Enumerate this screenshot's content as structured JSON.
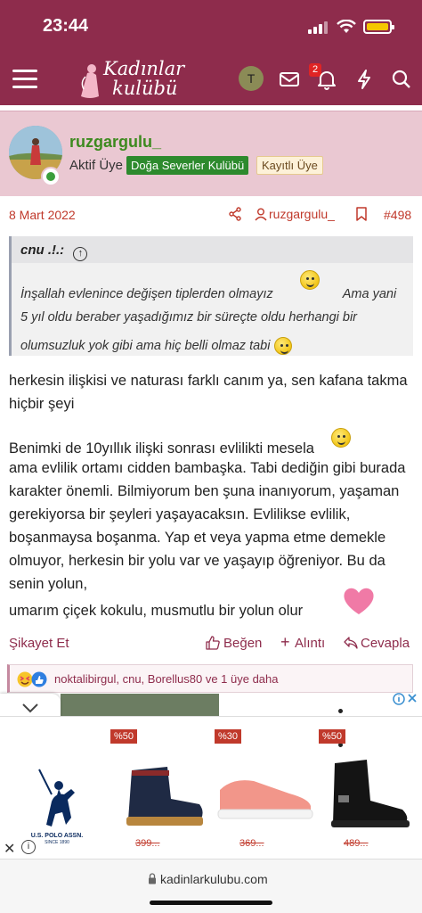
{
  "status_bar": {
    "time": "23:44"
  },
  "nav": {
    "logo_line1": "Kadınlar",
    "logo_line2": "kulübü",
    "avatar_letter": "T",
    "notification_count": "2"
  },
  "post": {
    "username": "ruzgargulu_",
    "user_title": "Aktif Üye",
    "badge_group": "Doğa Severler Kulübü",
    "badge_status": "Kayıtlı Üye",
    "date": "8 Mart 2022",
    "author_link": "ruzgargulu_",
    "post_number": "#498",
    "quote": {
      "author": "cnu .!.:",
      "line1": "İnşallah evlenince değişen tiplerden olmayız",
      "line1b": "Ama yani",
      "line2": "5 yıl oldu beraber yaşadığımız bir süreçte oldu herhangi bir",
      "line3": "olumsuzluk yok gibi ama hiç belli olmaz tabi"
    },
    "para1": "herkesin ilişkisi ve naturası farklı canım ya, sen kafana takma hiçbir şeyi",
    "para2_line1": "Benimki de 10yıllık ilişki sonrası evlilikti mesela",
    "para2_rest": "ama evlilik ortamı cidden bambaşka. Tabi dediğin gibi burada karakter önemli. Bilmiyorum ben şuna inanıyorum, yaşaman gerekiyorsa bir şeyleri yaşayacaksın. Evlilikse evlilik, boşanmaysa boşanma. Yap et veya yapma etme demekle olmuyor, herkesin bir yolu var ve yaşayıp öğreniyor. Bu da senin yolun,",
    "para3": "umarım çiçek kokulu, musmutlu bir yolun olur",
    "actions": {
      "report": "Şikayet Et",
      "like": "Beğen",
      "quote": "Alıntı",
      "reply": "Cevapla"
    },
    "reactions_text": "noktalibirgul, cnu, Borellus80 ve 1 üye daha"
  },
  "ad": {
    "brand": "U.S. POLO ASSN.",
    "brand_since": "SINCE 1890",
    "products": [
      {
        "discount": "%50",
        "price": "399..."
      },
      {
        "discount": "%30",
        "price": "369..."
      },
      {
        "discount": "%50",
        "price": "489..."
      }
    ]
  },
  "browser": {
    "url": "kadinlarkulubu.com"
  },
  "colors": {
    "brand": "#8e2c4c",
    "header_bg": "#eac8d2",
    "accent_red": "#c0392b",
    "username_green": "#3d8a1f"
  }
}
